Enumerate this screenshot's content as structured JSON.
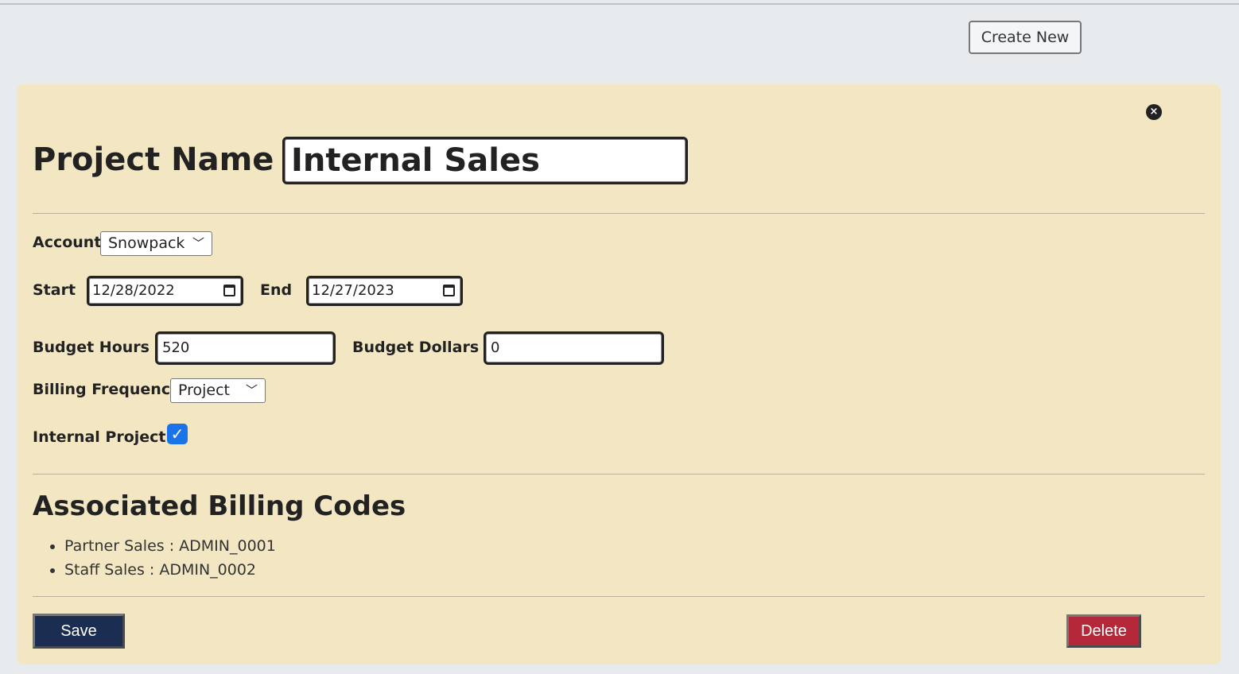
{
  "header": {
    "create_new_label": "Create New"
  },
  "project": {
    "name_label": "Project Name",
    "name_value": "Internal Sales",
    "account_label": "Account",
    "account_value": "Snowpack",
    "start_label": "Start",
    "start_value": "12/28/2022",
    "end_label": "End",
    "end_value": "12/27/2023",
    "budget_hours_label": "Budget Hours",
    "budget_hours_value": "520",
    "budget_dollars_label": "Budget Dollars",
    "budget_dollars_value": "0",
    "billing_frequency_label": "Billing Frequency",
    "billing_frequency_value": "Project",
    "internal_project_label": "Internal Project",
    "internal_project_checked": true
  },
  "billing_codes": {
    "title": "Associated Billing Codes",
    "items": [
      "Partner Sales : ADMIN_0001",
      "Staff Sales : ADMIN_0002"
    ]
  },
  "actions": {
    "save_label": "Save",
    "delete_label": "Delete"
  },
  "colors": {
    "panel_bg": "#f3e7c3",
    "save_bg": "#1c2d52",
    "delete_bg": "#b4283a",
    "checkbox_accent": "#1a73e8"
  },
  "icons": {
    "close": "close-icon",
    "dropdown": "chevron-down-icon",
    "calendar": "calendar-icon",
    "check": "checkmark-icon"
  }
}
